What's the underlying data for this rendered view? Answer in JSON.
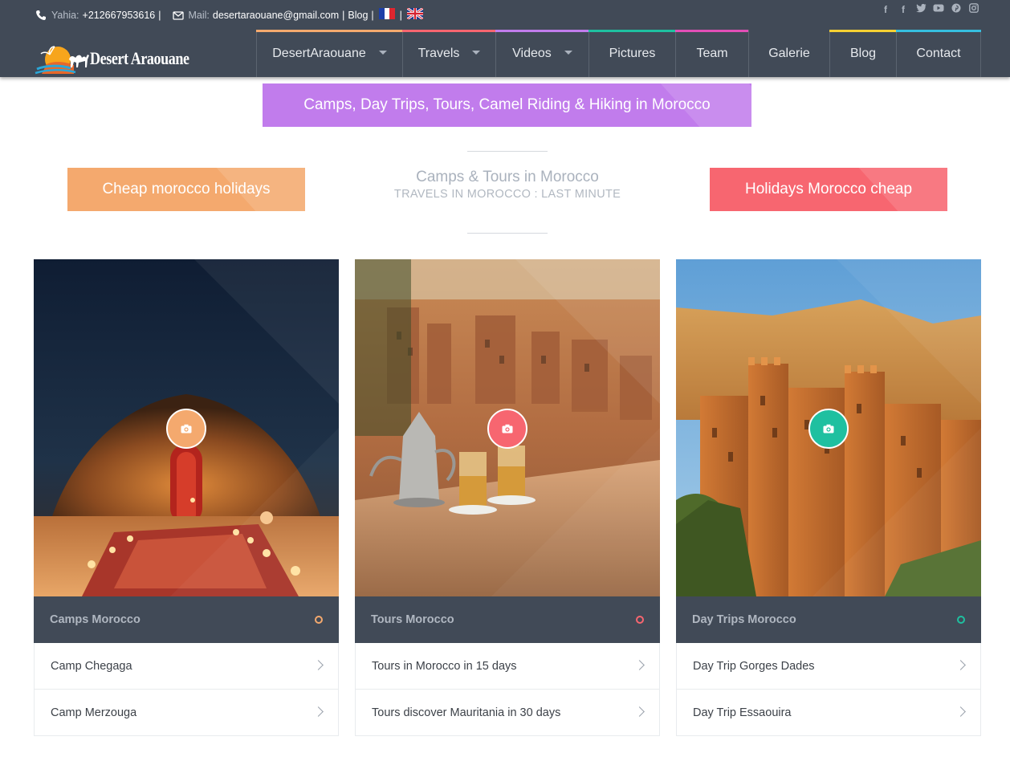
{
  "topbar": {
    "contact_label": "Yahia:",
    "phone": "+212667953616",
    "separator": "|",
    "mail_label": "Mail:",
    "email": "desertaraouane@gmail.com",
    "blog_link": "Blog"
  },
  "social_icons": [
    "facebook-icon",
    "facebook-icon",
    "twitter-icon",
    "youtube-icon",
    "pinterest-icon",
    "instagram-icon"
  ],
  "logo": {
    "text": "Desert Araouane"
  },
  "nav": {
    "items": [
      {
        "label": "DesertAraouane",
        "color": "#f4a96e",
        "dropdown": true
      },
      {
        "label": "Travels",
        "color": "#f76670",
        "dropdown": true
      },
      {
        "label": "Videos",
        "color": "#c17cec",
        "dropdown": true
      },
      {
        "label": "Pictures",
        "color": "#1fc0a0",
        "dropdown": false
      },
      {
        "label": "Team",
        "color": "#e24fb6",
        "dropdown": false
      },
      {
        "label": "Galerie",
        "color": "",
        "dropdown": false
      },
      {
        "label": "Blog",
        "color": "#f5d033",
        "dropdown": false
      },
      {
        "label": "Contact",
        "color": "#36bfe0",
        "dropdown": false
      }
    ]
  },
  "banner": {
    "text": "Camps, Day Trips, Tours, Camel Riding & Hiking in Morocco",
    "color": "#c17cec"
  },
  "left_button": {
    "label": "Cheap morocco holidays",
    "color": "#f4a96e"
  },
  "right_button": {
    "label": "Holidays Morocco cheap",
    "color": "#f76670"
  },
  "center_heading": {
    "title": "Camps & Tours in Morocco",
    "subtitle": "TRAVELS IN MOROCCO : LAST MINUTE"
  },
  "cards": [
    {
      "title": "Camps Morocco",
      "accent": "#f4a96e",
      "items": [
        "Camp Chegaga",
        "Camp Merzouga"
      ]
    },
    {
      "title": "Tours Morocco",
      "accent": "#f76670",
      "items": [
        "Tours in Morocco in 15 days",
        "Tours discover Mauritania in 30 days"
      ]
    },
    {
      "title": "Day Trips Morocco",
      "accent": "#1fc0a0",
      "items": [
        "Day Trip Gorges Dades",
        "Day Trip Essaouira"
      ]
    }
  ]
}
